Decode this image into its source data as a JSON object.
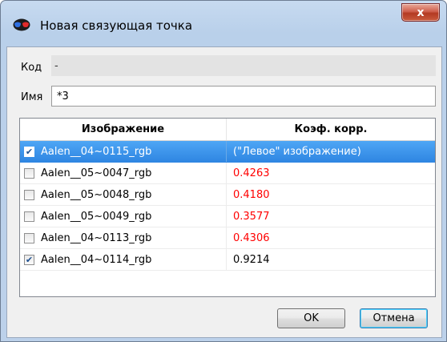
{
  "window": {
    "title": "Новая связующая точка",
    "close_label": "x"
  },
  "fields": {
    "code_label": "Код",
    "code_value": "-",
    "name_label": "Имя",
    "name_value": "*3"
  },
  "table": {
    "columns": [
      "Изображение",
      "Коэф. корр."
    ],
    "rows": [
      {
        "image": "Aalen__04~0115_rgb",
        "coef": "(\"Левое\" изображение)",
        "checked": true,
        "selected": true,
        "coef_color": "#ffffff"
      },
      {
        "image": "Aalen__05~0047_rgb",
        "coef": "0.4263",
        "checked": false,
        "selected": false,
        "coef_color": "#ff0000"
      },
      {
        "image": "Aalen__05~0048_rgb",
        "coef": "0.4180",
        "checked": false,
        "selected": false,
        "coef_color": "#ff0000"
      },
      {
        "image": "Aalen__05~0049_rgb",
        "coef": "0.3577",
        "checked": false,
        "selected": false,
        "coef_color": "#ff0000"
      },
      {
        "image": "Aalen__04~0113_rgb",
        "coef": "0.4306",
        "checked": false,
        "selected": false,
        "coef_color": "#ff0000"
      },
      {
        "image": "Aalen__04~0114_rgb",
        "coef": "0.9214",
        "checked": true,
        "selected": false,
        "coef_color": "#000000"
      }
    ]
  },
  "buttons": {
    "ok_label": "OK",
    "cancel_label": "Отмена"
  },
  "icons": {
    "app": "glasses-icon",
    "close": "close-icon",
    "checkbox": "checkmark-icon"
  }
}
